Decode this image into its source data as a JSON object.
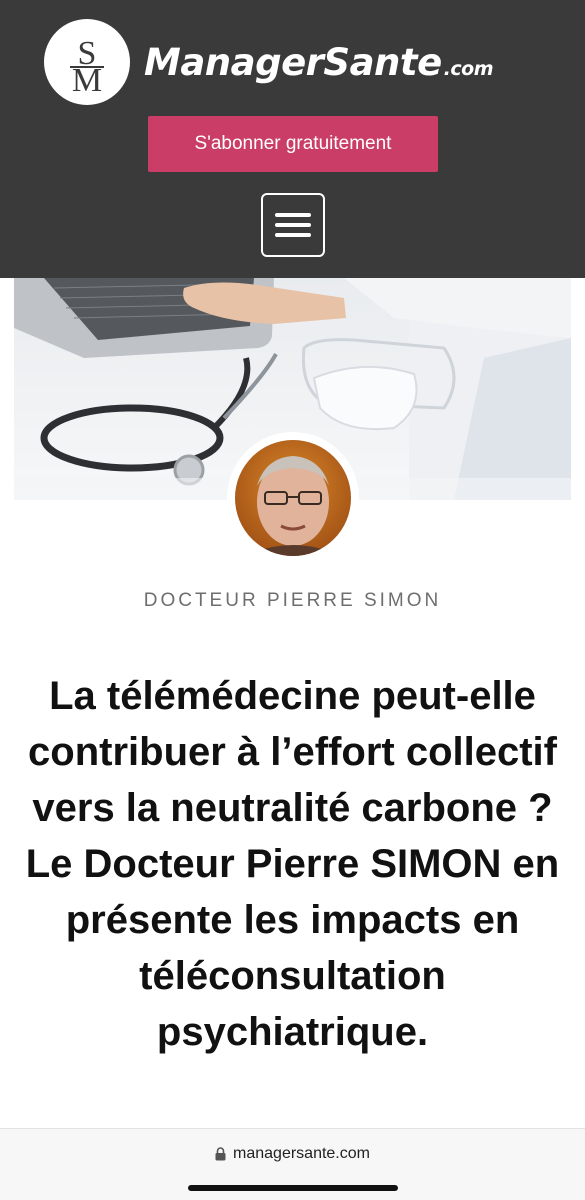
{
  "header": {
    "logo_monogram": "SM",
    "logo_text": "ManagerSante",
    "logo_tld": ".com",
    "subscribe_label": "S'abonner gratuitement",
    "menu_icon": "hamburger-icon",
    "colors": {
      "background": "#3a3a3b",
      "subscribe": "#c93d66"
    }
  },
  "article": {
    "author": "DOCTEUR PIERRE SIMON",
    "title": "La télémédecine peut-elle contribuer à l’effort collectif vers la neutralité carbone ? Le Docteur Pierre SIMON en présente les impacts en téléconsultation psychiatrique."
  },
  "browser": {
    "url": "managersante.com",
    "lock_icon": "lock-icon"
  }
}
